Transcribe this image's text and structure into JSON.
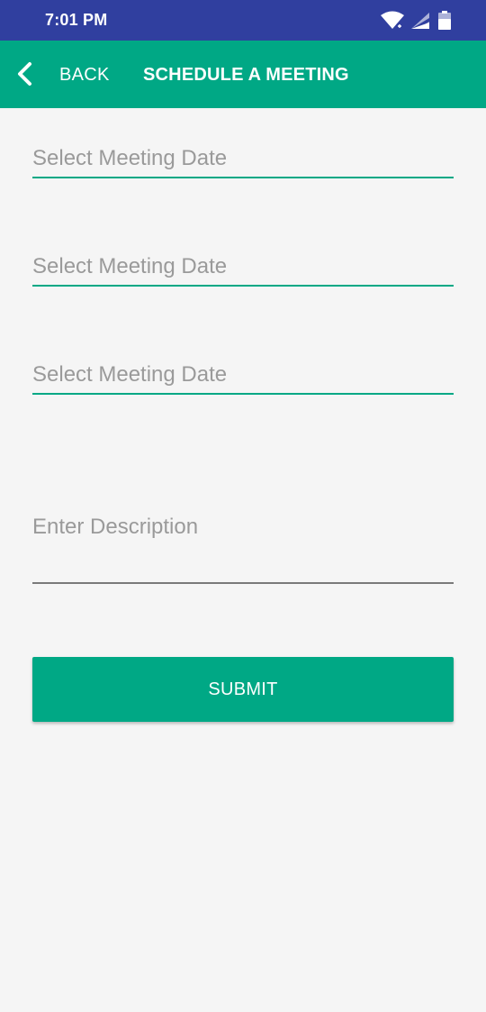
{
  "status_bar": {
    "time": "7:01 PM",
    "icons": [
      "wifi-icon",
      "signal-icon",
      "battery-icon"
    ]
  },
  "app_bar": {
    "back_label": "BACK",
    "title": "SCHEDULE A MEETING"
  },
  "form": {
    "date_field_1": {
      "placeholder": "Select Meeting Date",
      "value": ""
    },
    "date_field_2": {
      "placeholder": "Select Meeting Date",
      "value": ""
    },
    "date_field_3": {
      "placeholder": "Select Meeting Date",
      "value": ""
    },
    "description": {
      "placeholder": "Enter Description",
      "value": ""
    },
    "submit_label": "SUBMIT"
  },
  "colors": {
    "status_bar": "#303f9f",
    "accent": "#00a885",
    "background": "#f5f5f5",
    "placeholder": "#9a9a9a"
  }
}
